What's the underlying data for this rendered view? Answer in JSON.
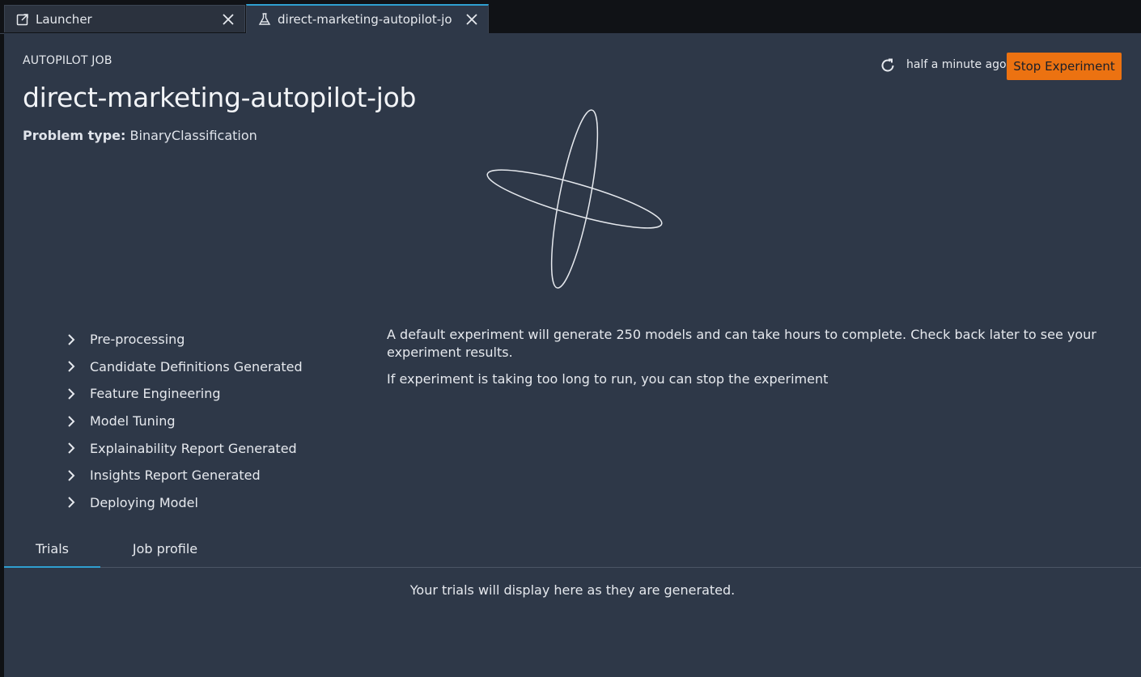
{
  "tabs": [
    {
      "label": "Launcher",
      "icon": "external-launch-icon"
    },
    {
      "label": "direct-marketing-autopilot-jo",
      "icon": "flask-icon"
    }
  ],
  "header": {
    "eyebrow": "AUTOPILOT JOB",
    "title": "direct-marketing-autopilot-job",
    "problem_label": "Problem type:",
    "problem_value": "BinaryClassification",
    "updated": "half a minute ago",
    "stop_label": "Stop Experiment"
  },
  "steps": [
    "Pre-processing",
    "Candidate Definitions Generated",
    "Feature Engineering",
    "Model Tuning",
    "Explainability Report Generated",
    "Insights Report Generated",
    "Deploying Model"
  ],
  "info": {
    "line1": "A default experiment will generate 250 models and can take hours to complete. Check back later to see your experiment results.",
    "line2": "If experiment is taking too long to run, you can stop the experiment"
  },
  "content_tabs": [
    "Trials",
    "Job profile"
  ],
  "empty_message": "Your trials will display here as they are generated.",
  "colors": {
    "accent": "#2f9fd0",
    "stop_button": "#ec7211",
    "panel": "#2e3848"
  }
}
